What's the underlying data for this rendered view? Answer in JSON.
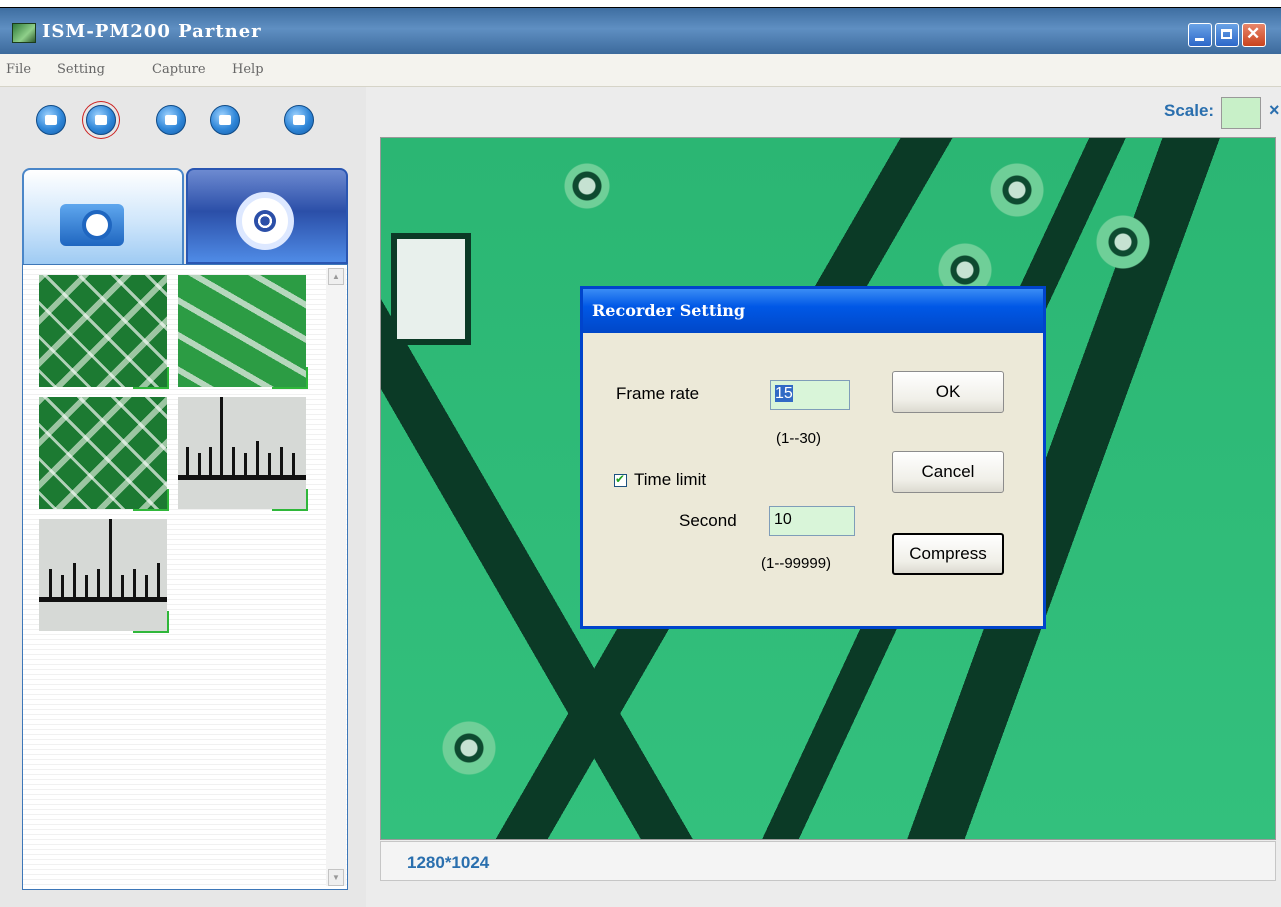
{
  "window": {
    "title": "ISM-PM200 Partner"
  },
  "menu": {
    "items": [
      "File",
      "Setting",
      "Capture",
      "Help"
    ]
  },
  "toolbar": {
    "buttons": [
      {
        "icon": "camera-icon"
      },
      {
        "icon": "video-record-icon",
        "active": true
      },
      {
        "icon": "measure-icon"
      },
      {
        "icon": "folder-icon"
      },
      {
        "icon": "save-icon"
      }
    ]
  },
  "tabs": {
    "photo": {
      "icon": "camera-tab-icon"
    },
    "video": {
      "icon": "film-reel-icon"
    }
  },
  "thumbnails": [
    {
      "kind": "pcb"
    },
    {
      "kind": "pcb"
    },
    {
      "kind": "pcb"
    },
    {
      "kind": "ruler"
    },
    {
      "kind": "ruler"
    }
  ],
  "viewer": {
    "scale_label": "Scale:",
    "scale_close": "×",
    "resolution": "1280*1024"
  },
  "dialog": {
    "title": "Recorder Setting",
    "frame_rate_label": "Frame rate",
    "frame_rate_value": "15",
    "frame_rate_range": "(1--30)",
    "time_limit_label": "Time limit",
    "time_limit_checked": true,
    "second_label": "Second",
    "second_value": "10",
    "second_range": "(1--99999)",
    "ok_label": "OK",
    "cancel_label": "Cancel",
    "compress_label": "Compress"
  },
  "colors": {
    "title_bar": "#3e6ea1",
    "dialog_title": "#0058e6",
    "accent_text": "#2a6fae",
    "input_bg": "#d9f5d9"
  }
}
